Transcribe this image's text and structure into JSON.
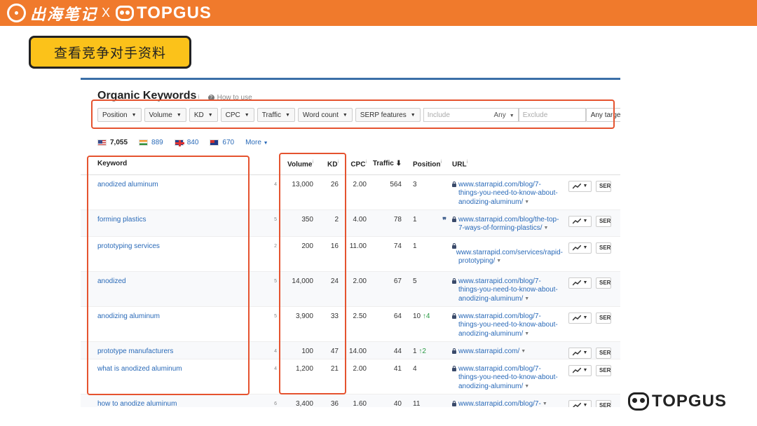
{
  "banner": {
    "brand_cn": "出海笔记",
    "separator": "X",
    "brand_en": "TOPGUS"
  },
  "callout": {
    "text": "查看竞争对手资料"
  },
  "panel": {
    "title": "Organic Keywords",
    "title_sup": "i",
    "how_to_use": "How to use",
    "filters": [
      "Position",
      "Volume",
      "KD",
      "CPC",
      "Traffic",
      "Word count",
      "SERP features"
    ],
    "include_placeholder": "Include",
    "include_mode": "Any",
    "exclude_placeholder": "Exclude",
    "target": "Any target",
    "countries": [
      {
        "flag": "us",
        "count": "7,055"
      },
      {
        "flag": "in",
        "count": "889"
      },
      {
        "flag": "uk",
        "count": "840"
      },
      {
        "flag": "au",
        "count": "670"
      }
    ],
    "more": "More",
    "columns": {
      "keyword": "Keyword",
      "volume": "Volume",
      "kd": "KD",
      "cpc": "CPC",
      "traffic": "Traffic",
      "position": "Position",
      "url": "URL"
    },
    "serp_label": "SERP",
    "rows": [
      {
        "keyword": "anodized aluminum",
        "idx": "4",
        "volume": "13,000",
        "kd": "26",
        "cpc": "2.00",
        "traffic": "564",
        "position": "3",
        "change": "",
        "url": [
          "www.starrapid.com/blog/7-",
          "things-you-need-to-know-about-",
          "anodizing-aluminum/"
        ],
        "quote": false
      },
      {
        "keyword": "forming plastics",
        "idx": "5",
        "volume": "350",
        "kd": "2",
        "cpc": "4.00",
        "traffic": "78",
        "position": "1",
        "change": "",
        "url": [
          "www.starrapid.com/blog/the-top-",
          "7-ways-of-forming-plastics/"
        ],
        "quote": true
      },
      {
        "keyword": "prototyping services",
        "idx": "2",
        "volume": "200",
        "kd": "16",
        "cpc": "11.00",
        "traffic": "74",
        "position": "1",
        "change": "",
        "url": [
          "",
          "www.starrapid.com/services/rapid-",
          "prototyping/"
        ],
        "quote": false
      },
      {
        "keyword": "anodized",
        "idx": "5",
        "volume": "14,000",
        "kd": "24",
        "cpc": "2.00",
        "traffic": "67",
        "position": "5",
        "change": "",
        "url": [
          "www.starrapid.com/blog/7-",
          "things-you-need-to-know-about-",
          "anodizing-aluminum/"
        ],
        "quote": false
      },
      {
        "keyword": "anodizing aluminum",
        "idx": "5",
        "volume": "3,900",
        "kd": "33",
        "cpc": "2.50",
        "traffic": "64",
        "position": "10",
        "change": "4",
        "url": [
          "www.starrapid.com/blog/7-",
          "things-you-need-to-know-about-",
          "anodizing-aluminum/"
        ],
        "quote": false
      },
      {
        "keyword": "prototype manufacturers",
        "idx": "4",
        "volume": "100",
        "kd": "47",
        "cpc": "14.00",
        "traffic": "44",
        "position": "1",
        "change": "2",
        "url": [
          "www.starrapid.com/"
        ],
        "quote": false
      },
      {
        "keyword": "what is anodized aluminum",
        "idx": "4",
        "volume": "1,200",
        "kd": "21",
        "cpc": "2.00",
        "traffic": "41",
        "position": "4",
        "change": "",
        "url": [
          "www.starrapid.com/blog/7-",
          "things-you-need-to-know-about-",
          "anodizing-aluminum/"
        ],
        "quote": false
      },
      {
        "keyword": "how to anodize aluminum",
        "idx": "6",
        "volume": "3,400",
        "kd": "36",
        "cpc": "1.60",
        "traffic": "40",
        "position": "11",
        "change": "",
        "url": [
          "www.starrapid.com/blog/7-"
        ],
        "quote": false
      }
    ]
  },
  "watermark": {
    "text": "TOPGUS"
  },
  "colors": {
    "banner": "#f07a2c",
    "callout": "#fbc21a",
    "highlight": "#e5532f",
    "link": "#2a6ab8"
  }
}
